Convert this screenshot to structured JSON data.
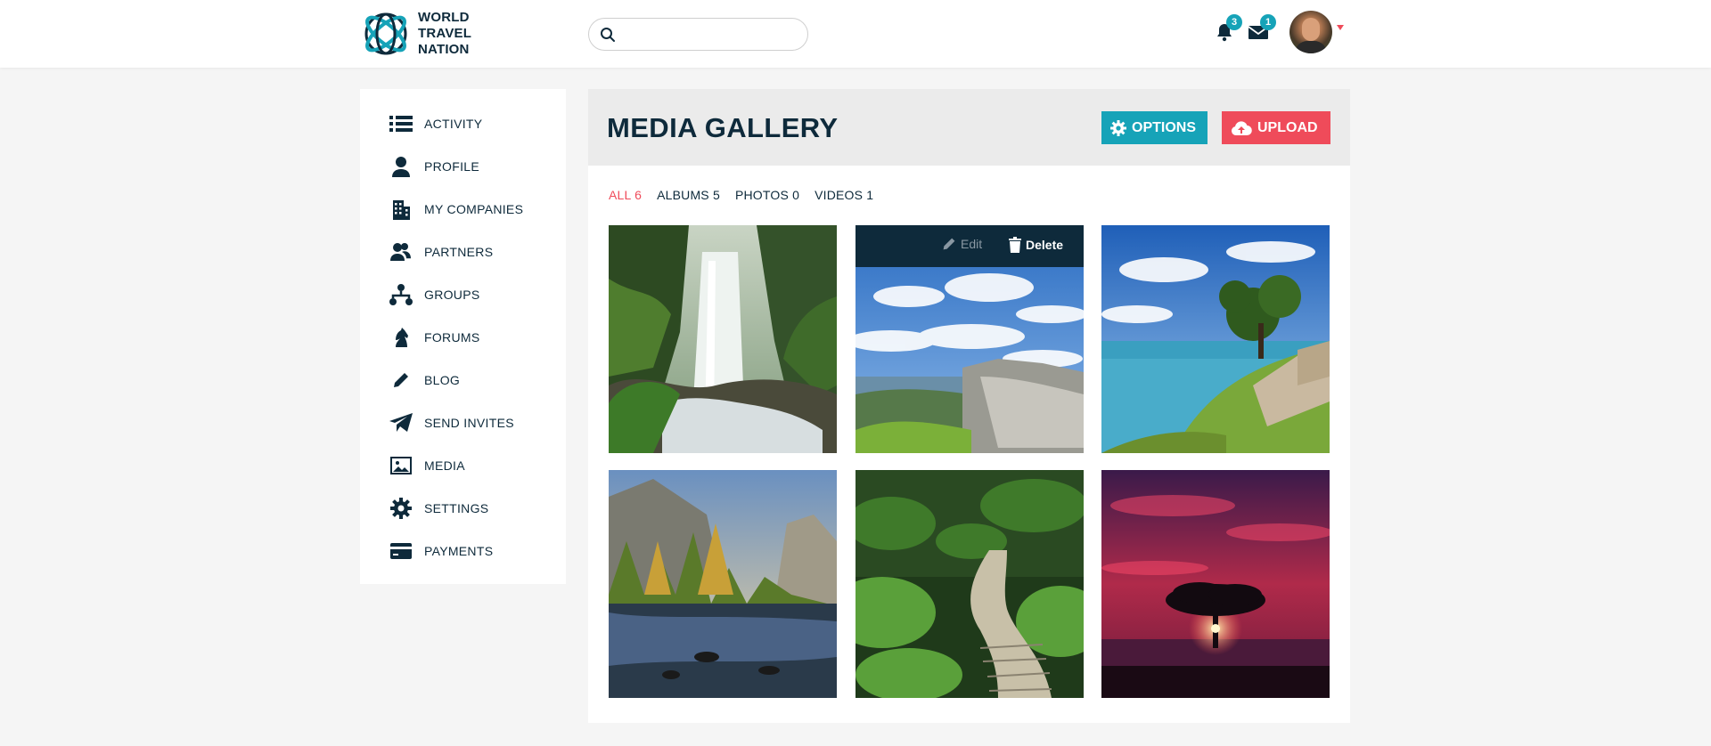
{
  "header": {
    "brand": [
      "WORLD",
      "TRAVEL",
      "NATION"
    ],
    "search": {
      "placeholder": "",
      "value": ""
    },
    "notifications_count": "3",
    "messages_count": "1",
    "accent": "#16a3b8"
  },
  "sidebar": {
    "items": [
      {
        "label": "ACTIVITY",
        "icon": "list-icon"
      },
      {
        "label": "PROFILE",
        "icon": "user-icon"
      },
      {
        "label": "MY COMPANIES",
        "icon": "building-icon"
      },
      {
        "label": "PARTNERS",
        "icon": "partners-icon"
      },
      {
        "label": "GROUPS",
        "icon": "sitemap-icon"
      },
      {
        "label": "FORUMS",
        "icon": "chess-knight-icon"
      },
      {
        "label": "BLOG",
        "icon": "pencil-icon"
      },
      {
        "label": "SEND INVITES",
        "icon": "paper-plane-icon"
      },
      {
        "label": "MEDIA",
        "icon": "image-icon"
      },
      {
        "label": "SETTINGS",
        "icon": "gear-icon"
      },
      {
        "label": "PAYMENTS",
        "icon": "credit-card-icon"
      }
    ]
  },
  "main": {
    "title": "MEDIA GALLERY",
    "options_label": "OPTIONS",
    "upload_label": "UPLOAD",
    "filters": [
      {
        "label": "ALL 6",
        "active": true
      },
      {
        "label": "ALBUMS 5",
        "active": false
      },
      {
        "label": "PHOTOS 0",
        "active": false
      },
      {
        "label": "VIDEOS 1",
        "active": false
      }
    ],
    "overlay": {
      "edit_label": "Edit",
      "delete_label": "Delete"
    },
    "tiles": [
      "waterfall",
      "cliff-sky",
      "coast-bench",
      "mountain-lake",
      "forest-boardwalk",
      "sunset-tree"
    ]
  },
  "colors": {
    "primary": "#16a3b8",
    "danger": "#ef4b5a",
    "navy": "#0e2a3b"
  }
}
